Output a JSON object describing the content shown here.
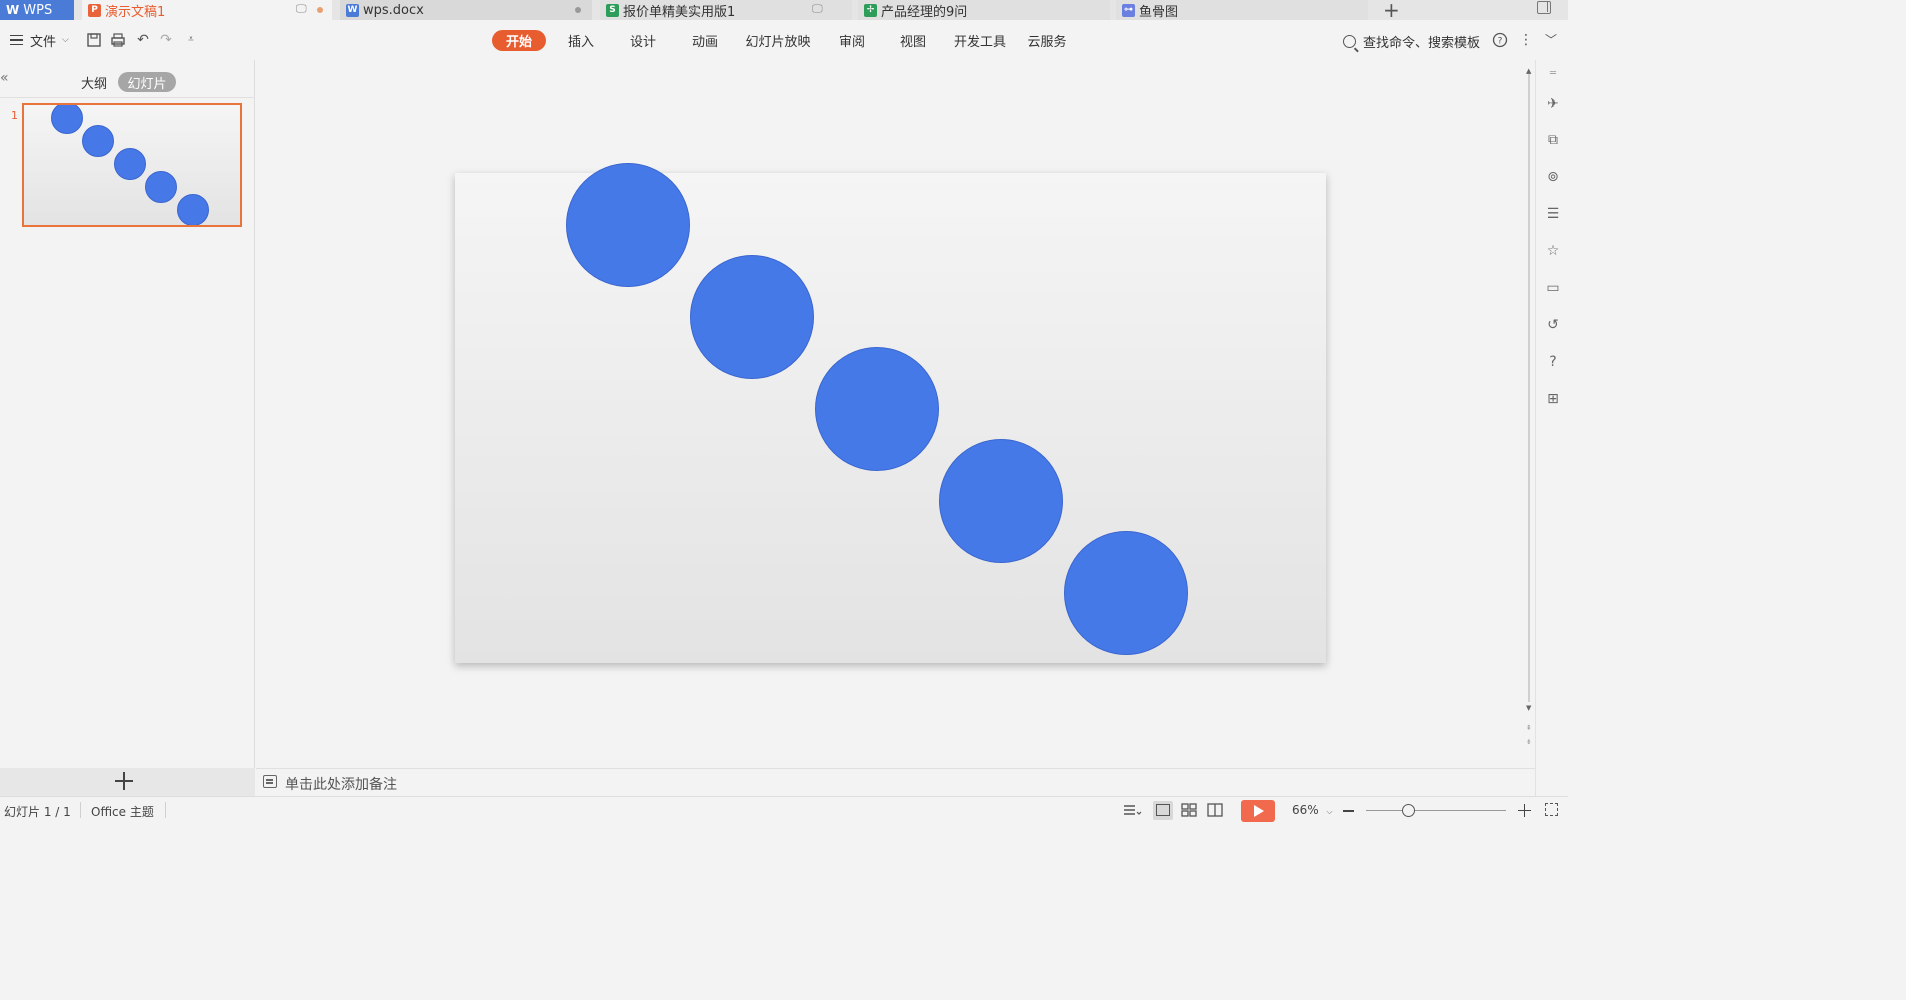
{
  "tabs": {
    "wps": "WPS",
    "active": "演示文稿1",
    "doc": "wps.docx",
    "sheet": "报价单精美实用版1",
    "mind": "产品经理的9问",
    "fish": "鱼骨图"
  },
  "toolbar": {
    "file": "文件",
    "menu": [
      "开始",
      "插入",
      "设计",
      "动画",
      "幻灯片放映",
      "审阅",
      "视图",
      "开发工具",
      "云服务"
    ],
    "search": "查找命令、搜索模板"
  },
  "panel": {
    "outline_tab": "大纲",
    "slides_tab": "幻灯片",
    "slide_number": "1"
  },
  "notes": {
    "placeholder": "单击此处添加备注"
  },
  "status": {
    "slide_info": "幻灯片 1 / 1",
    "theme": "Office 主题",
    "zoom": "66%"
  },
  "colors": {
    "accent": "#e85d2f",
    "shape_fill": "#4679e8"
  },
  "slide": {
    "shape_count": 5,
    "shape_type": "circle"
  }
}
